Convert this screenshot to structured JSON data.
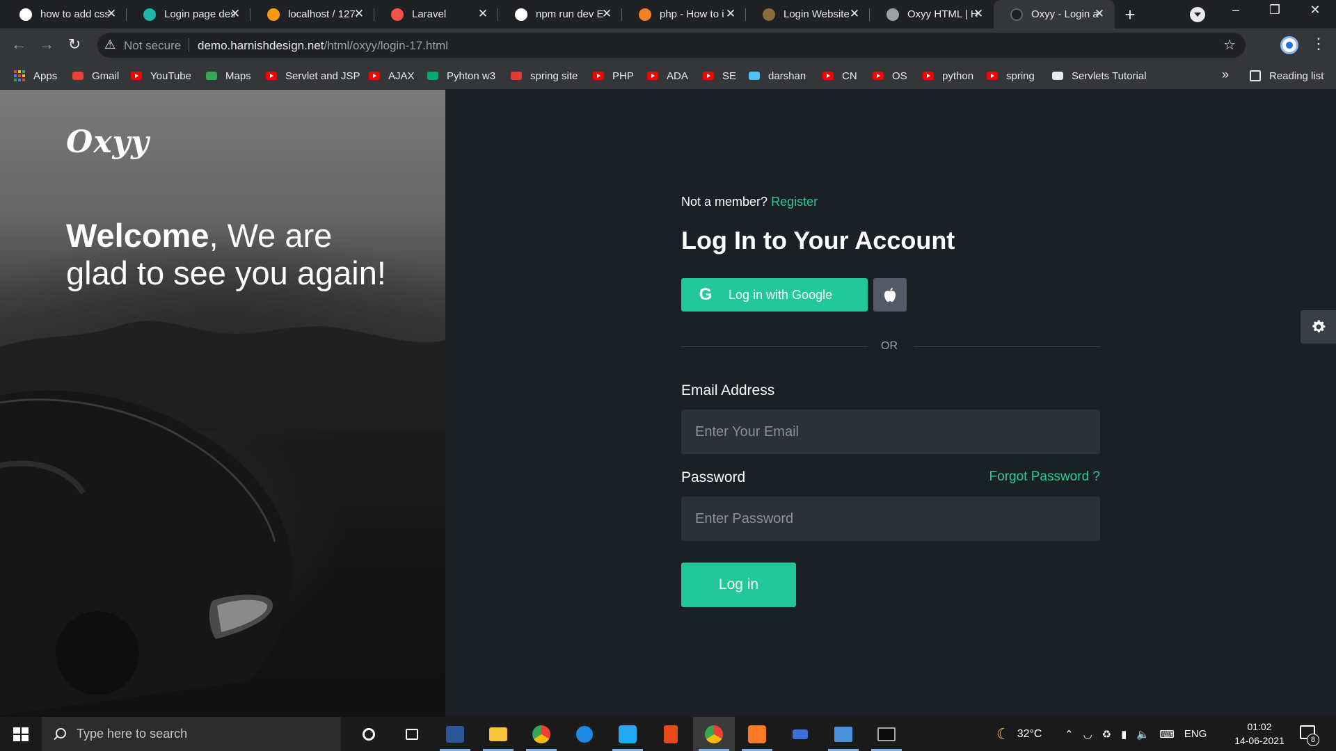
{
  "browser": {
    "tabs": [
      {
        "title": "how to add css",
        "favicon_color": "#ffffff",
        "favicon_icon": "google-icon",
        "active": false
      },
      {
        "title": "Login page des",
        "favicon_color": "#1fb5ad",
        "favicon_icon": "codepen-icon",
        "active": false
      },
      {
        "title": "localhost / 127.",
        "favicon_color": "#f89c0e",
        "favicon_icon": "phpmyadmin-icon",
        "active": false
      },
      {
        "title": "Laravel",
        "favicon_color": "#f55247",
        "favicon_icon": "laravel-icon",
        "active": false
      },
      {
        "title": "npm run dev E",
        "favicon_color": "#ffffff",
        "favicon_icon": "github-icon",
        "active": false
      },
      {
        "title": "php - How to i",
        "favicon_color": "#f48024",
        "favicon_icon": "stackoverflow-icon",
        "active": false
      },
      {
        "title": "Login Website",
        "favicon_color": "#8a6d3b",
        "favicon_icon": "bookmark-page-icon",
        "active": false
      },
      {
        "title": "Oxyy HTML | H",
        "favicon_color": "#9aa0a6",
        "favicon_icon": "globe-icon",
        "active": false
      },
      {
        "title": "Oxyy - Login a",
        "favicon_color": "#202124",
        "favicon_icon": "loading-icon",
        "active": true
      }
    ],
    "address": {
      "security_label": "Not secure",
      "url_host": "demo.harnishdesign.net",
      "url_path": "/html/oxyy/login-17.html"
    },
    "bookmarks": [
      {
        "label": "Apps",
        "icon": "apps-grid-icon"
      },
      {
        "label": "Gmail",
        "icon": "gmail-icon"
      },
      {
        "label": "YouTube",
        "icon": "youtube-icon"
      },
      {
        "label": "Maps",
        "icon": "maps-icon"
      },
      {
        "label": "Servlet and JSP",
        "icon": "youtube-icon"
      },
      {
        "label": "AJAX",
        "icon": "youtube-icon"
      },
      {
        "label": "Pyhton w3",
        "icon": "w3schools-icon"
      },
      {
        "label": "spring site",
        "icon": "spring-icon"
      },
      {
        "label": "PHP",
        "icon": "youtube-icon"
      },
      {
        "label": "ADA",
        "icon": "youtube-icon"
      },
      {
        "label": "SE",
        "icon": "youtube-icon"
      },
      {
        "label": "darshan",
        "icon": "darshan-icon"
      },
      {
        "label": "CN",
        "icon": "youtube-icon"
      },
      {
        "label": "OS",
        "icon": "youtube-icon"
      },
      {
        "label": "python",
        "icon": "youtube-icon"
      },
      {
        "label": "spring",
        "icon": "youtube-icon"
      },
      {
        "label": "Servlets Tutorial",
        "icon": "javatpoint-icon"
      }
    ],
    "bookmarks_overflow": "»",
    "reading_list": "Reading list"
  },
  "page": {
    "logo": "Oxyy",
    "welcome_bold": "Welcome",
    "welcome_rest": ", We are glad to see you again!",
    "not_member": "Not a member?",
    "register_link": "Register",
    "heading": "Log In to Your Account",
    "google_button": "Log in with Google",
    "or_text": "OR",
    "email_label": "Email Address",
    "email_placeholder": "Enter Your Email",
    "email_value": "",
    "password_label": "Password",
    "password_placeholder": "Enter Password",
    "password_value": "",
    "forgot_link": "Forgot Password ?",
    "login_button": "Log in",
    "accent_color": "#20c997"
  },
  "taskbar": {
    "search_placeholder": "Type here to search",
    "apps": [
      "cortana-icon",
      "task-view-icon",
      "word-icon",
      "file-explorer-icon",
      "chrome-icon",
      "safari-icon",
      "vscode-icon",
      "office-icon",
      "chrome-canary-icon",
      "xampp-icon",
      "wamp-icon",
      "photos-icon",
      "terminal-icon"
    ],
    "weather_temp": "32°C",
    "language": "ENG",
    "time": "01:02",
    "date": "14-06-2021",
    "notification_count": "8"
  }
}
